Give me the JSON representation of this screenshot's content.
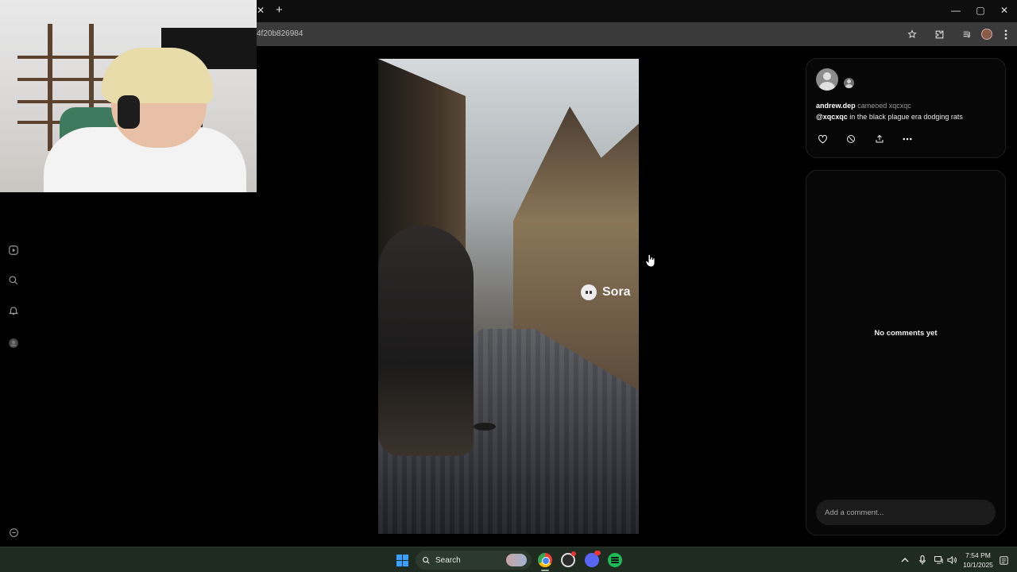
{
  "browser": {
    "url": "4f20b826984",
    "tab_close_glyph": "✕",
    "new_tab_glyph": "+",
    "window_controls": {
      "minimize": "—",
      "maximize": "▢",
      "close": "✕"
    }
  },
  "icons": {
    "rail": [
      "play-icon",
      "search-icon",
      "bell-icon",
      "profile-icon",
      "settings-icon"
    ],
    "toolbar": [
      "star-icon",
      "extensions-icon",
      "media-icon",
      "avatar",
      "menu-icon"
    ]
  },
  "video": {
    "watermark": "Sora",
    "description": ""
  },
  "post": {
    "username": "andrew.dep",
    "cameo_text": " cameoed xqcxqc",
    "mention": "@xqcxqc",
    "caption": " in the black plague era dodging rats",
    "actions": [
      "like-icon",
      "remix-icon",
      "share-icon",
      "more-icon"
    ]
  },
  "comments": {
    "empty_text": "No comments yet",
    "placeholder": "Add a comment..."
  },
  "taskbar": {
    "search_label": "Search",
    "time": "7:54 PM",
    "date": "10/1/2025"
  },
  "colors": {
    "background": "#000000",
    "panel_border": "#1f1f1f",
    "taskbar": "#1f2a20",
    "windows_blue": "#3aa0ff"
  }
}
